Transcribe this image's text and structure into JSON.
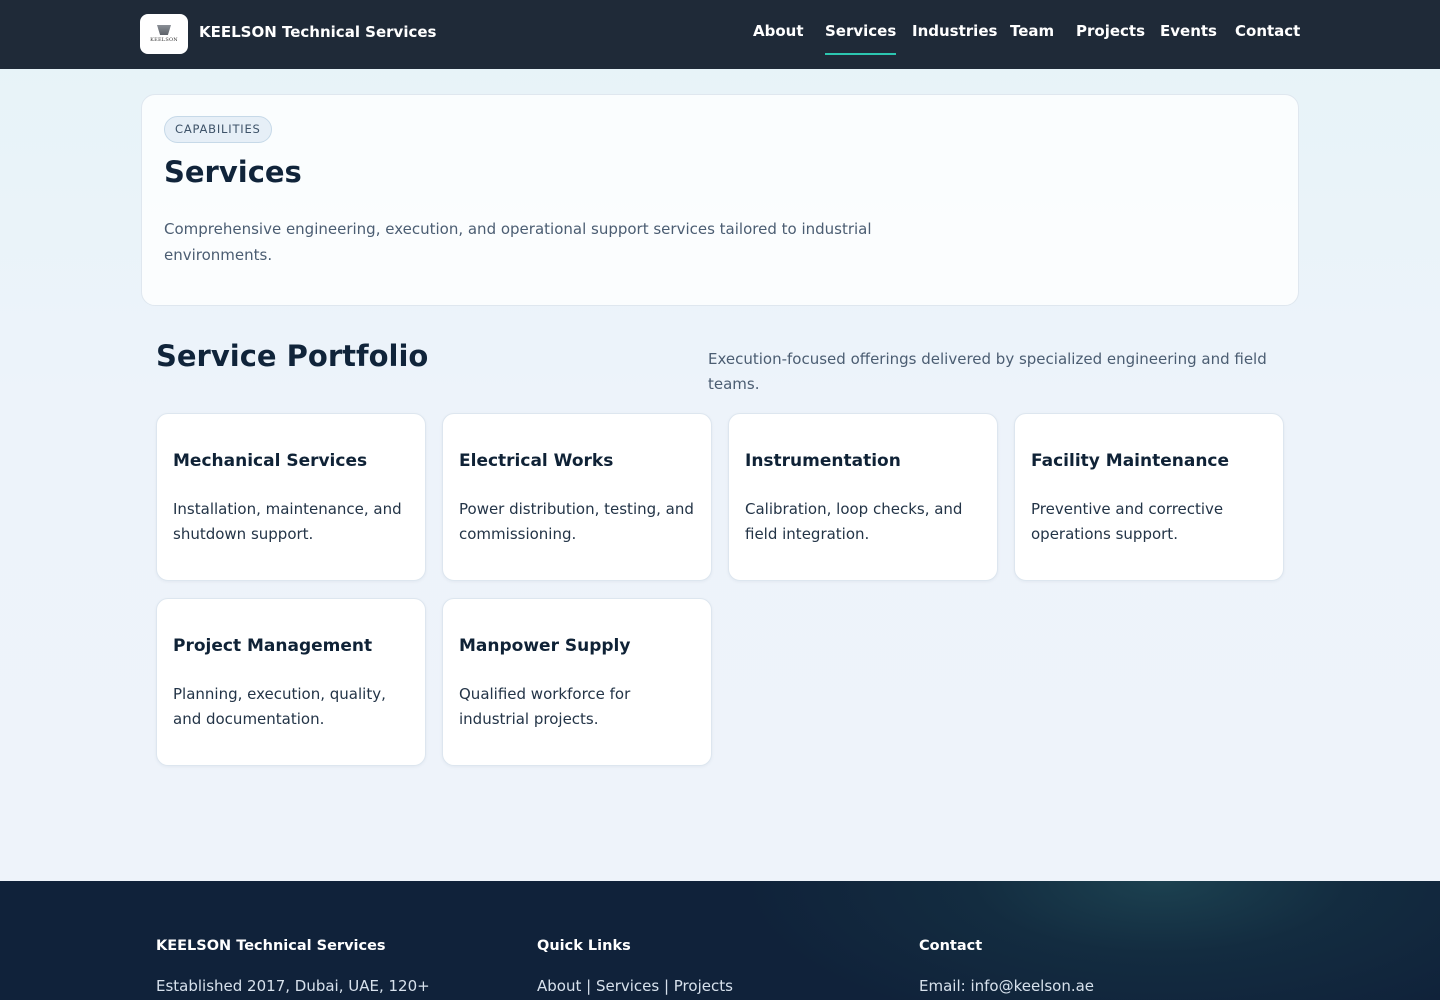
{
  "header": {
    "logo_text": "KEELSON",
    "brand": "KEELSON Technical Services",
    "nav": [
      {
        "label": "About"
      },
      {
        "label": "Services",
        "active": true
      },
      {
        "label": "Industries"
      },
      {
        "label": "Team"
      },
      {
        "label": "Projects"
      },
      {
        "label": "Events"
      },
      {
        "label": "Contact"
      }
    ]
  },
  "hero": {
    "badge": "CAPABILITIES",
    "title": "Services",
    "description": "Comprehensive engineering, execution, and operational support services tailored to industrial environments."
  },
  "portfolio": {
    "title": "Service Portfolio",
    "subtitle": "Execution-focused offerings delivered by specialized engineering and field teams.",
    "cards": [
      {
        "title": "Mechanical Services",
        "description": "Installation, maintenance, and shutdown support."
      },
      {
        "title": "Electrical Works",
        "description": "Power distribution, testing, and commissioning."
      },
      {
        "title": "Instrumentation",
        "description": "Calibration, loop checks, and field integration."
      },
      {
        "title": "Facility Maintenance",
        "description": "Preventive and corrective operations support."
      },
      {
        "title": "Project Management",
        "description": "Planning, execution, quality, and documentation."
      },
      {
        "title": "Manpower Supply",
        "description": "Qualified workforce for industrial projects."
      }
    ]
  },
  "footer": {
    "company_heading": "KEELSON Technical Services",
    "company_text": "Established 2017, Dubai, UAE, 120+",
    "links_heading": "Quick Links",
    "links_text": "About | Services | Projects",
    "contact_heading": "Contact",
    "contact_text": "Email: info@keelson.ae"
  },
  "colors": {
    "header_bg": "#1f2a38",
    "accent": "#2cc6b0",
    "footer_bg": "#10223a"
  }
}
